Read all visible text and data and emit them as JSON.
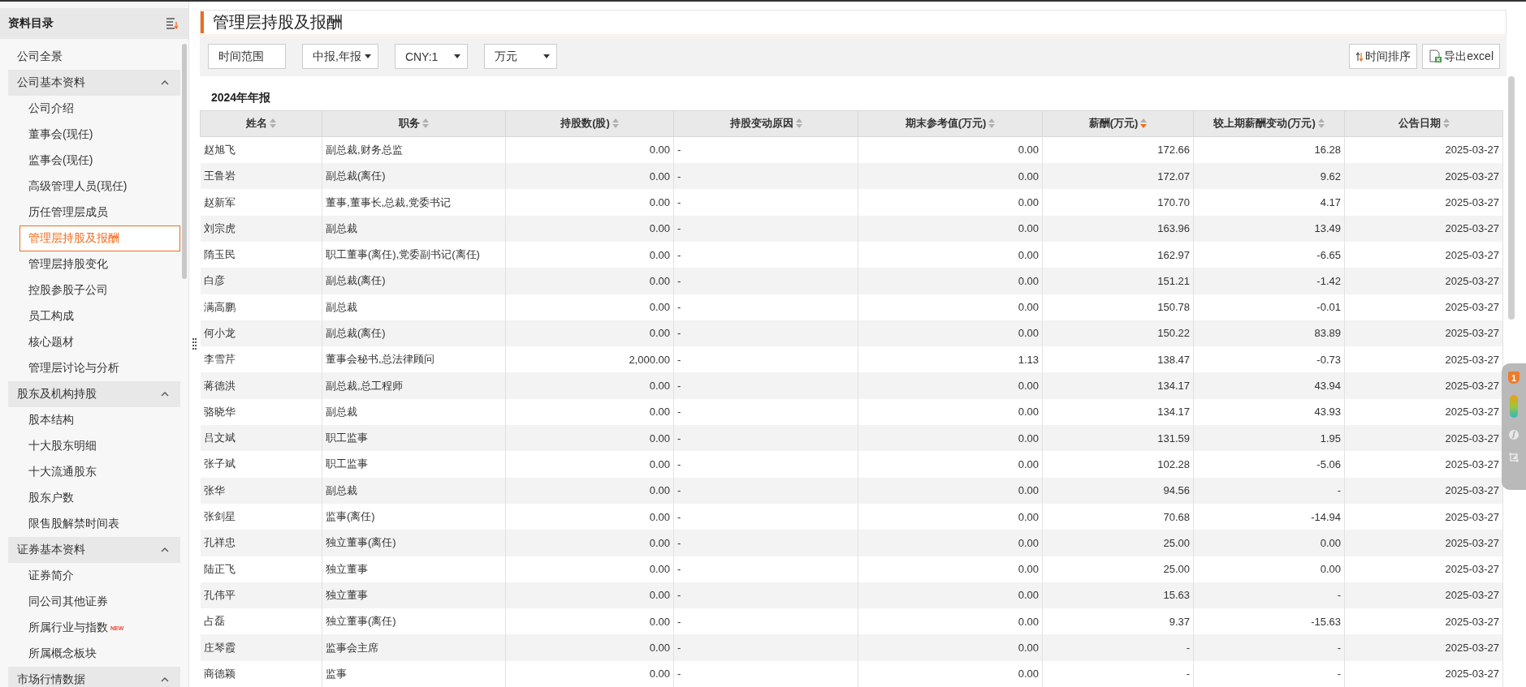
{
  "sidebar": {
    "title": "资料目录",
    "items": [
      {
        "label": "公司全景",
        "kind": "item",
        "selected": false
      },
      {
        "label": "公司基本资料",
        "kind": "group",
        "expanded": true,
        "children": [
          {
            "label": "公司介绍",
            "selected": false
          },
          {
            "label": "董事会(现任)",
            "selected": false
          },
          {
            "label": "监事会(现任)",
            "selected": false
          },
          {
            "label": "高级管理人员(现任)",
            "selected": false
          },
          {
            "label": "历任管理层成员",
            "selected": false
          },
          {
            "label": "管理层持股及报酬",
            "selected": true
          },
          {
            "label": "管理层持股变化",
            "selected": false
          },
          {
            "label": "控股参股子公司",
            "selected": false
          },
          {
            "label": "员工构成",
            "selected": false
          },
          {
            "label": "核心题材",
            "selected": false
          },
          {
            "label": "管理层讨论与分析",
            "selected": false
          }
        ]
      },
      {
        "label": "股东及机构持股",
        "kind": "group",
        "expanded": true,
        "children": [
          {
            "label": "股本结构",
            "selected": false
          },
          {
            "label": "十大股东明细",
            "selected": false
          },
          {
            "label": "十大流通股东",
            "selected": false
          },
          {
            "label": "股东户数",
            "selected": false
          },
          {
            "label": "限售股解禁时间表",
            "selected": false
          }
        ]
      },
      {
        "label": "证券基本资料",
        "kind": "group",
        "expanded": true,
        "children": [
          {
            "label": "证券简介",
            "selected": false
          },
          {
            "label": "同公司其他证券",
            "selected": false
          },
          {
            "label": "所属行业与指数",
            "badge": "NEW",
            "selected": false
          },
          {
            "label": "所属概念板块",
            "selected": false
          }
        ]
      },
      {
        "label": "市场行情数据",
        "kind": "group",
        "expanded": true
      }
    ]
  },
  "page": {
    "title": "管理层持股及报酬"
  },
  "toolbar": {
    "range_button": "时间范围",
    "dropdowns": [
      "中报,年报",
      "CNY:1",
      "万元"
    ],
    "sort_button": "时间排序",
    "export_button": "导出excel"
  },
  "section_title": "2024年年报",
  "table": {
    "columns": [
      {
        "label": "姓名",
        "sorted_desc": false
      },
      {
        "label": "职务",
        "sorted_desc": false
      },
      {
        "label": "持股数(股)",
        "sorted_desc": false
      },
      {
        "label": "持股变动原因",
        "sorted_desc": false
      },
      {
        "label": "期末参考值(万元)",
        "sorted_desc": false
      },
      {
        "label": "薪酬(万元)",
        "sorted_desc": true
      },
      {
        "label": "较上期薪酬变动(万元)",
        "sorted_desc": false
      },
      {
        "label": "公告日期",
        "sorted_desc": false
      }
    ],
    "rows": [
      [
        "赵旭飞",
        "副总裁,财务总监",
        "0.00",
        "-",
        "0.00",
        "172.66",
        "16.28",
        "2025-03-27"
      ],
      [
        "王鲁岩",
        "副总裁(离任)",
        "0.00",
        "-",
        "0.00",
        "172.07",
        "9.62",
        "2025-03-27"
      ],
      [
        "赵新军",
        "董事,董事长,总裁,党委书记",
        "0.00",
        "-",
        "0.00",
        "170.70",
        "4.17",
        "2025-03-27"
      ],
      [
        "刘宗虎",
        "副总裁",
        "0.00",
        "-",
        "0.00",
        "163.96",
        "13.49",
        "2025-03-27"
      ],
      [
        "隋玉民",
        "职工董事(离任),党委副书记(离任)",
        "0.00",
        "-",
        "0.00",
        "162.97",
        "-6.65",
        "2025-03-27"
      ],
      [
        "白彦",
        "副总裁(离任)",
        "0.00",
        "-",
        "0.00",
        "151.21",
        "-1.42",
        "2025-03-27"
      ],
      [
        "满高鹏",
        "副总裁",
        "0.00",
        "-",
        "0.00",
        "150.78",
        "-0.01",
        "2025-03-27"
      ],
      [
        "何小龙",
        "副总裁(离任)",
        "0.00",
        "-",
        "0.00",
        "150.22",
        "83.89",
        "2025-03-27"
      ],
      [
        "李雪芹",
        "董事会秘书,总法律顾问",
        "2,000.00",
        "-",
        "1.13",
        "138.47",
        "-0.73",
        "2025-03-27"
      ],
      [
        "蒋德洪",
        "副总裁,总工程师",
        "0.00",
        "-",
        "0.00",
        "134.17",
        "43.94",
        "2025-03-27"
      ],
      [
        "骆晓华",
        "副总裁",
        "0.00",
        "-",
        "0.00",
        "134.17",
        "43.93",
        "2025-03-27"
      ],
      [
        "吕文斌",
        "职工监事",
        "0.00",
        "-",
        "0.00",
        "131.59",
        "1.95",
        "2025-03-27"
      ],
      [
        "张子斌",
        "职工监事",
        "0.00",
        "-",
        "0.00",
        "102.28",
        "-5.06",
        "2025-03-27"
      ],
      [
        "张华",
        "副总裁",
        "0.00",
        "-",
        "0.00",
        "94.56",
        "-",
        "2025-03-27"
      ],
      [
        "张剑星",
        "监事(离任)",
        "0.00",
        "-",
        "0.00",
        "70.68",
        "-14.94",
        "2025-03-27"
      ],
      [
        "孔祥忠",
        "独立董事(离任)",
        "0.00",
        "-",
        "0.00",
        "25.00",
        "0.00",
        "2025-03-27"
      ],
      [
        "陆正飞",
        "独立董事",
        "0.00",
        "-",
        "0.00",
        "25.00",
        "0.00",
        "2025-03-27"
      ],
      [
        "孔伟平",
        "独立董事",
        "0.00",
        "-",
        "0.00",
        "15.63",
        "-",
        "2025-03-27"
      ],
      [
        "占磊",
        "独立董事(离任)",
        "0.00",
        "-",
        "0.00",
        "9.37",
        "-15.63",
        "2025-03-27"
      ],
      [
        "庄琴霞",
        "监事会主席",
        "0.00",
        "-",
        "0.00",
        "-",
        "-",
        "2025-03-27"
      ],
      [
        "商德颖",
        "监事",
        "0.00",
        "-",
        "0.00",
        "-",
        "-",
        "2025-03-27"
      ]
    ]
  },
  "side_widget": {
    "badge": "1"
  }
}
